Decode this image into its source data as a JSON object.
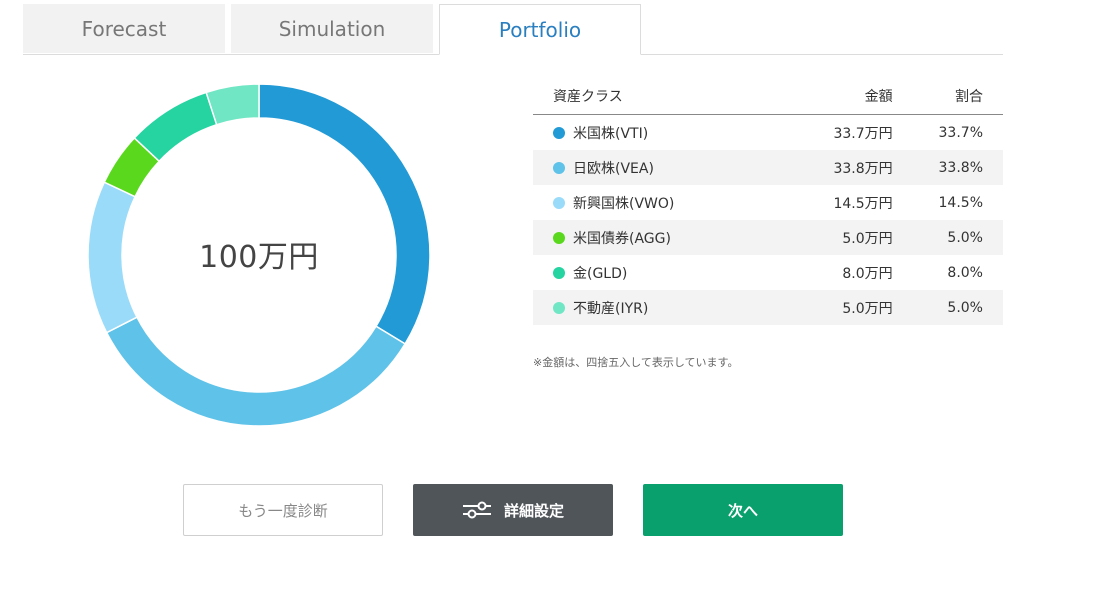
{
  "tabs": [
    {
      "label": "Forecast",
      "active": false
    },
    {
      "label": "Simulation",
      "active": false
    },
    {
      "label": "Portfolio",
      "active": true
    }
  ],
  "donut": {
    "total_label": "100万円"
  },
  "table": {
    "headers": {
      "asset_class": "資産クラス",
      "amount": "金額",
      "ratio": "割合"
    },
    "rows": [
      {
        "name": "米国株(VTI)",
        "amount": "33.7万円",
        "ratio": "33.7%",
        "percent": 33.7,
        "color": "#229ad6"
      },
      {
        "name": "日欧株(VEA)",
        "amount": "33.8万円",
        "ratio": "33.8%",
        "percent": 33.8,
        "color": "#5fc2e8"
      },
      {
        "name": "新興国株(VWO)",
        "amount": "14.5万円",
        "ratio": "14.5%",
        "percent": 14.5,
        "color": "#9adbfa"
      },
      {
        "name": "米国債券(AGG)",
        "amount": "5.0万円",
        "ratio": "5.0%",
        "percent": 5.0,
        "color": "#5ad81e"
      },
      {
        "name": "金(GLD)",
        "amount": "8.0万円",
        "ratio": "8.0%",
        "percent": 8.0,
        "color": "#25d4a0"
      },
      {
        "name": "不動産(IYR)",
        "amount": "5.0万円",
        "ratio": "5.0%",
        "percent": 5.0,
        "color": "#70e6c4"
      }
    ]
  },
  "note": "※金額は、四捨五入して表示しています。",
  "buttons": {
    "retry": "もう一度診断",
    "settings": "詳細設定",
    "next": "次へ"
  },
  "icons": {
    "settings": "sliders-icon"
  }
}
